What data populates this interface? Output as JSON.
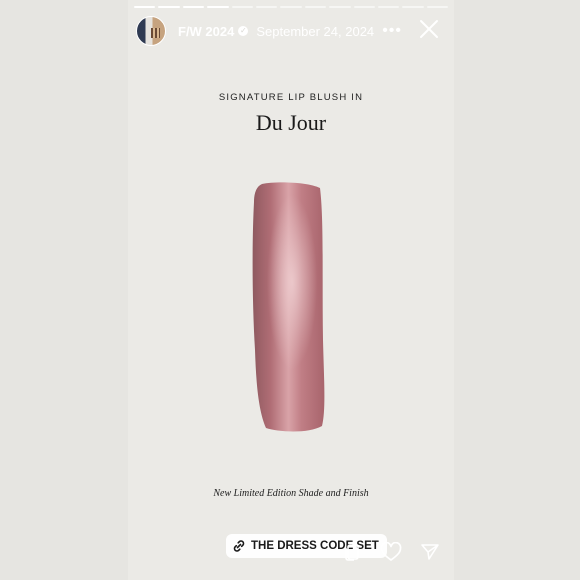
{
  "story": {
    "progress_total": 13,
    "progress_done": 4,
    "username": "F/W 2024",
    "date": "September 24, 2024",
    "more_label": "•••",
    "verified_glyph": "✓"
  },
  "content": {
    "kicker": "SIGNATURE LIP BLUSH IN",
    "shade_name": "Du Jour",
    "caption": "New Limited Edition Shade and Finish",
    "swatch_color": "#b7737a"
  },
  "link_sticker": {
    "label": "THE DRESS CODE SET",
    "icon": "link-icon"
  },
  "actions": {
    "icons": [
      "share-copy-icon",
      "heart-icon",
      "send-icon"
    ]
  }
}
